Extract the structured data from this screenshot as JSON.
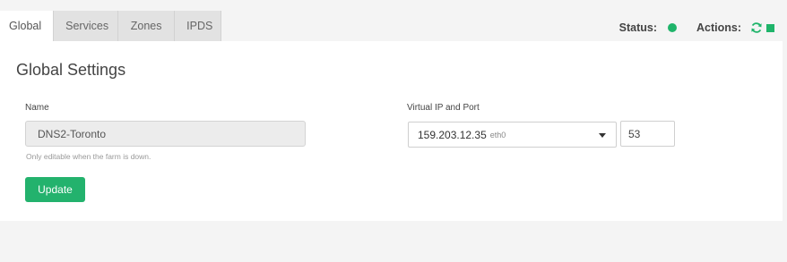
{
  "tabs": [
    {
      "label": "Global",
      "active": true
    },
    {
      "label": "Services",
      "active": false
    },
    {
      "label": "Zones",
      "active": false
    },
    {
      "label": "IPDS",
      "active": false
    }
  ],
  "status": {
    "label": "Status:",
    "color": "#1fb46a"
  },
  "actions": {
    "label": "Actions:",
    "icons": [
      "refresh-icon",
      "stop-icon"
    ],
    "color": "#1fb46a"
  },
  "panel": {
    "title": "Global Settings",
    "name": {
      "label": "Name",
      "value": "DNS2-Toronto",
      "help": "Only editable when the farm is down."
    },
    "vip": {
      "label": "Virtual IP and Port",
      "ip": "159.203.12.35",
      "interface": "eth0",
      "port": "53"
    },
    "update_label": "Update"
  }
}
